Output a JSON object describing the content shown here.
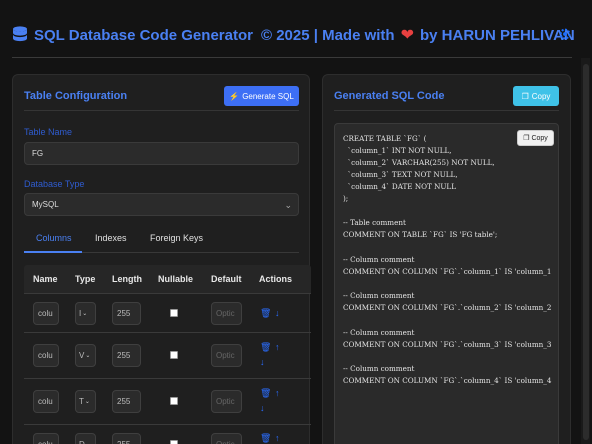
{
  "header": {
    "title_part1": "SQL Database Code Generator",
    "title_part2": "© 2025 | Made with",
    "title_part3": "by HARUN PEHLIVAN",
    "heart": "❤",
    "db_icon": "database-icon",
    "settings_icon": "gear-icon"
  },
  "left": {
    "title": "Table Configuration",
    "generate_label": "Generate SQL",
    "table_name_label": "Table Name",
    "table_name_value": "FG",
    "db_type_label": "Database Type",
    "db_type_value": "MySQL",
    "tabs": [
      {
        "label": "Columns",
        "active": true
      },
      {
        "label": "Indexes",
        "active": false
      },
      {
        "label": "Foreign Keys",
        "active": false
      }
    ],
    "table_headers": [
      "Name",
      "Type",
      "Length",
      "Nullable",
      "Default",
      "Actions"
    ],
    "rows": [
      {
        "name": "colu",
        "type": "I",
        "length": "255",
        "nullable": false,
        "default_placeholder": "Optic",
        "actions": [
          "trash-icon",
          "arrow-down-icon"
        ]
      },
      {
        "name": "colu",
        "type": "V",
        "length": "255",
        "nullable": false,
        "default_placeholder": "Optic",
        "actions": [
          "trash-icon",
          "arrow-up-icon",
          "arrow-down-icon"
        ]
      },
      {
        "name": "colu",
        "type": "T",
        "length": "255",
        "nullable": false,
        "default_placeholder": "Optic",
        "actions": [
          "trash-icon",
          "arrow-up-icon",
          "arrow-down-icon"
        ]
      },
      {
        "name": "colu",
        "type": "D",
        "length": "255",
        "nullable": false,
        "default_placeholder": "Optic",
        "actions": [
          "trash-icon",
          "arrow-up-icon"
        ]
      }
    ]
  },
  "right": {
    "title": "Generated SQL Code",
    "copy_label": "Copy",
    "code_copy_label": "Copy",
    "code_lines": [
      "CREATE TABLE `FG` (",
      "  `column_1` INT NOT NULL,",
      "  `column_2` VARCHAR(255) NOT NULL,",
      "  `column_3` TEXT NOT NULL,",
      "  `column_4` DATE NOT NULL",
      ");",
      "",
      "-- Table comment",
      "COMMENT ON TABLE `FG` IS 'FG table';",
      "",
      "-- Column comment",
      "COMMENT ON COLUMN `FG`.`column_1` IS 'column_1",
      "",
      "-- Column comment",
      "COMMENT ON COLUMN `FG`.`column_2` IS 'column_2",
      "",
      "-- Column comment",
      "COMMENT ON COLUMN `FG`.`column_3` IS 'column_3",
      "",
      "-- Column comment",
      "COMMENT ON COLUMN `FG`.`column_4` IS 'column_4"
    ]
  },
  "colors": {
    "accent": "#4a80f2",
    "primary_button": "#3d6ff5",
    "copy_button": "#3fc2e8",
    "heart": "#e84040",
    "background": "#131313",
    "panel": "#1f1f1f"
  }
}
